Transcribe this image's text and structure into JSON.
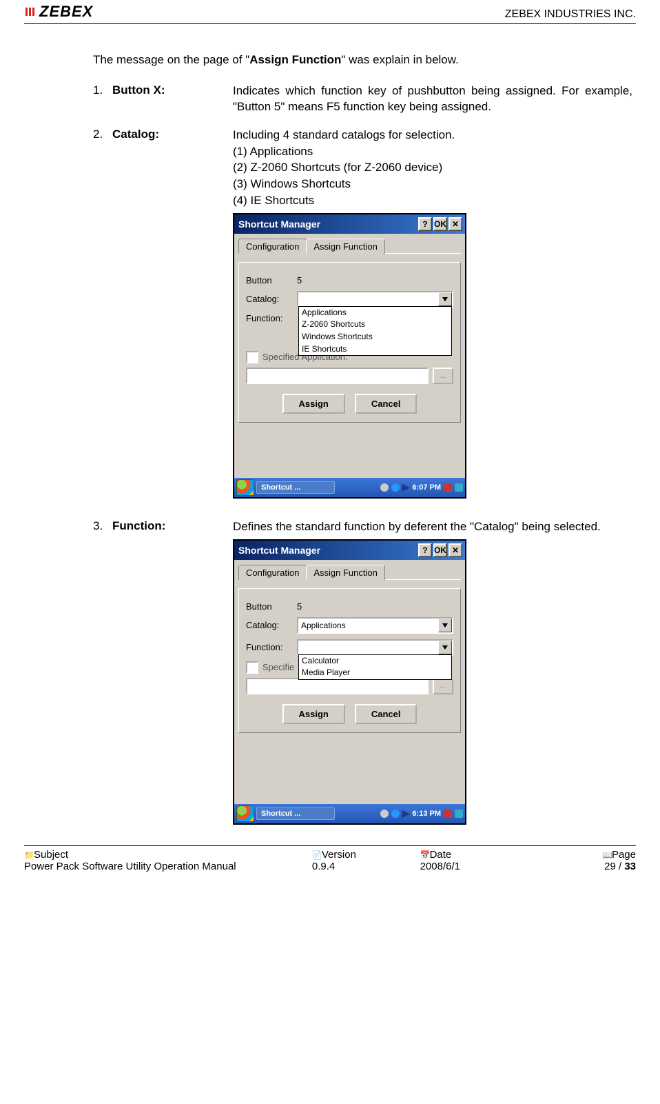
{
  "header": {
    "logo_text": "ZEBEX",
    "company": "ZEBEX INDUSTRIES INC."
  },
  "intro_prefix": "The message on the page of \"",
  "intro_bold": "Assign Function",
  "intro_suffix": "\" was explain in below.",
  "items": [
    {
      "num": "1.",
      "label": "Button X:",
      "desc": "Indicates which function key of pushbutton being assigned. For example,  \"Button 5\" means F5 function key being assigned."
    },
    {
      "num": "2.",
      "label": "Catalog:",
      "desc": "Including 4 standard catalogs for selection.",
      "sublist": [
        "(1) Applications",
        "(2) Z-2060 Shortcuts (for Z-2060 device)",
        "(3) Windows Shortcuts",
        "(4) IE Shortcuts"
      ]
    },
    {
      "num": "3.",
      "label": "Function:",
      "desc": "Defines the  standard function by deferent the \"Catalog\" being selected."
    }
  ],
  "dialog": {
    "title": "Shortcut Manager",
    "help": "?",
    "ok": "OK",
    "close": "✕",
    "tabs": {
      "config": "Configuration",
      "assign": "Assign Function"
    },
    "button_label": "Button",
    "button_value": "5",
    "catalog_label": "Catalog:",
    "function_label": "Function:",
    "spec_label_a": "Specified Application:",
    "spec_label_b": "Specifie",
    "browse": "...",
    "assign_btn": "Assign",
    "cancel_btn": "Cancel",
    "catalog_options": [
      "Applications",
      "Z-2060 Shortcuts",
      "Windows Shortcuts",
      "IE Shortcuts"
    ],
    "catalog_selected": "Applications",
    "function_options": [
      "Calculator",
      "Media Player"
    ],
    "taskbar_app": "Shortcut ...",
    "time_a": "6:07 PM",
    "time_b": "6:13 PM"
  },
  "footer": {
    "labels": {
      "subject": "Subject",
      "version": "Version",
      "date": "Date",
      "page": "Page"
    },
    "subject": "Power Pack Software Utility Operation Manual",
    "version": "0.9.4",
    "date": "2008/6/1",
    "page_current": "29",
    "page_sep": " / ",
    "page_total": "33"
  }
}
